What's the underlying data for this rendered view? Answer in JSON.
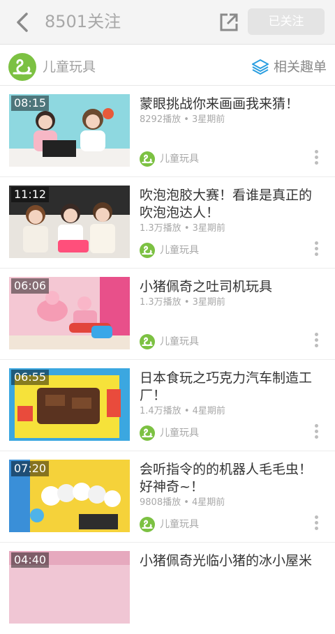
{
  "header": {
    "title": "8501关注",
    "back_icon": "chevron-left-icon",
    "share_icon": "share-external-icon",
    "follow_button_label": "已关注"
  },
  "channel": {
    "name": "儿童玩具",
    "related_label": "相关趣单",
    "related_icon": "layers-icon",
    "brand_color": "#7cc142",
    "accent_color": "#2a9ee0"
  },
  "videos": [
    {
      "duration": "08:15",
      "title": "蒙眼挑战你来画画我来猜！",
      "views": "8292播放",
      "age": "3星期前",
      "channel": "儿童玩具"
    },
    {
      "duration": "11:12",
      "title": "吹泡泡胶大赛！看谁是真正的吹泡泡达人！",
      "views": "1.3万播放",
      "age": "3星期前",
      "channel": "儿童玩具"
    },
    {
      "duration": "06:06",
      "title": "小猪佩奇之吐司机玩具",
      "views": "1.3万播放",
      "age": "3星期前",
      "channel": "儿童玩具"
    },
    {
      "duration": "06:55",
      "title": "日本食玩之巧克力汽车制造工厂！",
      "views": "1.4万播放",
      "age": "4星期前",
      "channel": "儿童玩具"
    },
    {
      "duration": "07:20",
      "title": "会听指令的的机器人毛毛虫！好神奇~！",
      "views": "9808播放",
      "age": "4星期前",
      "channel": "儿童玩具"
    },
    {
      "duration": "04:40",
      "title": "小猪佩奇光临小猪的冰小屋米",
      "views": "",
      "age": "",
      "channel": ""
    }
  ],
  "meta_separator": " • "
}
